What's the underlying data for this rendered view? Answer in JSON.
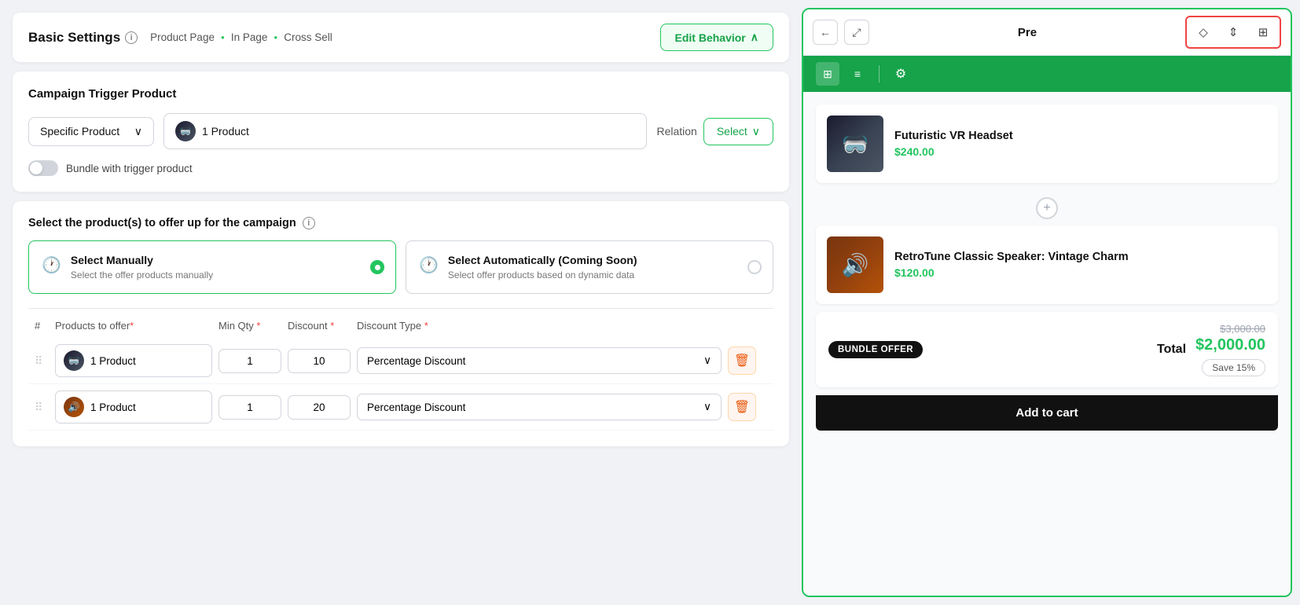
{
  "header": {
    "title": "Basic Settings",
    "breadcrumb": [
      "Product Page",
      "In Page",
      "Cross Sell"
    ],
    "edit_behavior": "Edit Behavior",
    "info_icon": "ⓘ"
  },
  "campaign": {
    "title": "Campaign Trigger Product",
    "trigger_type": "Specific Product",
    "product_count": "1 Product",
    "relation_label": "Relation",
    "select_label": "Select",
    "bundle_label": "Bundle with trigger product"
  },
  "offer": {
    "title": "Select the product(s) to offer up for the campaign",
    "options": [
      {
        "id": "manual",
        "title": "Select Manually",
        "desc": "Select the offer products manually",
        "active": true
      },
      {
        "id": "auto",
        "title": "Select Automatically (Coming Soon)",
        "desc": "Select offer products based on dynamic data",
        "active": false
      }
    ]
  },
  "table": {
    "headers": [
      "#",
      "Products to offer",
      "Min Qty",
      "Discount",
      "Discount Type",
      ""
    ],
    "rows": [
      {
        "product": "1 Product",
        "min_qty": "1",
        "discount": "10",
        "discount_type": "Percentage Discount"
      },
      {
        "product": "1 Product",
        "min_qty": "1",
        "discount": "20",
        "discount_type": "Percentage Discount"
      }
    ]
  },
  "preview": {
    "label": "Pre",
    "products": [
      {
        "name": "Futuristic VR Headset",
        "price": "$240.00",
        "emoji": "🥽"
      },
      {
        "name": "RetroTune Classic Speaker: Vintage Charm",
        "price": "$120.00",
        "emoji": "🔊"
      }
    ],
    "bundle_badge": "BUNDLE OFFER",
    "total_label": "Total",
    "original_price": "$3,000.00",
    "final_price": "$2,000.00",
    "save_label": "Save 15%",
    "add_to_cart": "Add to cart"
  },
  "toolbar": {
    "back_icon": "←",
    "expand_icon": "⤢",
    "paint_icon": "◇",
    "resize_icon": "⇕",
    "sliders_icon": "⊞",
    "grid_icon": "⊞",
    "list_icon": "≡",
    "gear_icon": "⚙"
  }
}
